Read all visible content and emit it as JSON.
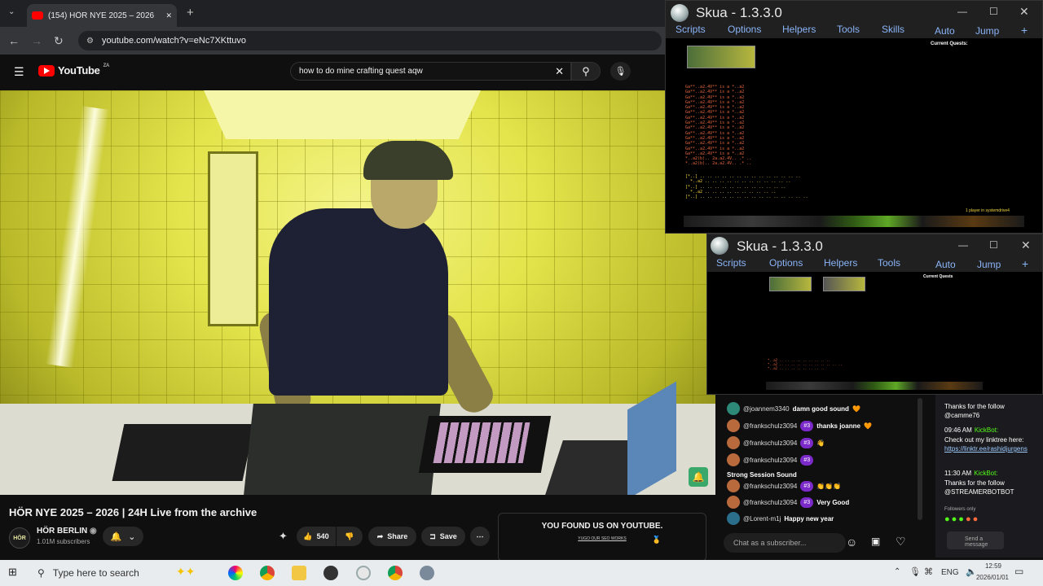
{
  "browser": {
    "tab_title": "(154) HÖR NYE 2025 – 2026",
    "url": "youtube.com/watch?v=eNc7XKttuvo"
  },
  "youtube": {
    "logo": "YouTube",
    "region": "ZA",
    "search_query": "how to do mine crafting quest aqw",
    "video_title": "HÖR NYE 2025 – 2026 | 24H Live from the archive",
    "channel_name": "HÖR BERLIN",
    "channel_avatar_text": "HÖR",
    "subscribers": "1.01M subscribers",
    "like_count": "540",
    "share_label": "Share",
    "save_label": "Save",
    "ad_title": "YOU FOUND US ON YOUTUBE.",
    "ad_subtitle": "YUGO OUR SEO WORKS"
  },
  "skua_top": {
    "title": "Skua - 1.3.3.0",
    "menu": [
      "Scripts",
      "Options",
      "Helpers",
      "Tools",
      "Skills"
    ],
    "right_menu": [
      "Auto",
      "Jump"
    ],
    "current_quests": "Current Quests:",
    "players": "1 player in systemdrive4"
  },
  "skua_bottom": {
    "title": "Skua - 1.3.3.0",
    "menu": [
      "Scripts",
      "Options",
      "Helpers",
      "Tools"
    ],
    "right_menu": [
      "Auto",
      "Jump"
    ],
    "current_quests": "Current Quests"
  },
  "chat": {
    "messages": [
      {
        "user": "@joannem3340",
        "badge": "",
        "text": "damn good sound"
      },
      {
        "user": "@frankschulz3094",
        "badge": "#3",
        "text": "thanks joanne"
      },
      {
        "user": "@frankschulz3094",
        "badge": "#3",
        "text": ""
      },
      {
        "user": "@frankschulz3094",
        "badge": "#3",
        "text": "Strong Session Sound"
      },
      {
        "user": "@frankschulz3094",
        "badge": "#3",
        "text": ""
      },
      {
        "user": "@frankschulz3094",
        "badge": "#3",
        "text": "Very Good"
      },
      {
        "user": "@Lorent-m1j",
        "badge": "",
        "text": "Happy new year"
      }
    ],
    "input_placeholder": "Chat as a subscriber..."
  },
  "kick": {
    "line1": "Thanks for the follow",
    "user1": "@camme76",
    "time2": "09:46 AM",
    "bot": "KickBot:",
    "line2": "Check out my linktree here:",
    "link": "https://linktr.ee/rashidjurgens",
    "time3": "11:30 AM",
    "line3": "Thanks for the follow",
    "user3": "@STREAMERBOTBOT",
    "followers_only": "Followers only",
    "send": "Send a message"
  },
  "taskbar": {
    "search_placeholder": "Type here to search",
    "language": "ENG",
    "time": "12:59",
    "date": "2026/01/01"
  },
  "colors": {
    "youtube_red": "#ff0000",
    "skua_menu": "#8ab4f8",
    "kick_green": "#53fc18"
  }
}
